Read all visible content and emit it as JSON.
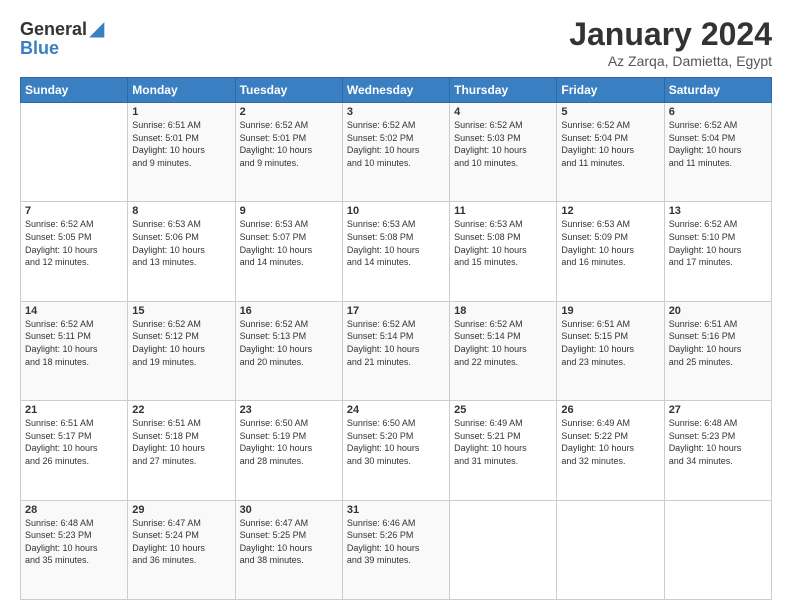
{
  "header": {
    "logo_line1": "General",
    "logo_line2": "Blue",
    "title": "January 2024",
    "subtitle": "Az Zarqa, Damietta, Egypt"
  },
  "weekdays": [
    "Sunday",
    "Monday",
    "Tuesday",
    "Wednesday",
    "Thursday",
    "Friday",
    "Saturday"
  ],
  "weeks": [
    [
      {
        "day": "",
        "info": ""
      },
      {
        "day": "1",
        "info": "Sunrise: 6:51 AM\nSunset: 5:01 PM\nDaylight: 10 hours\nand 9 minutes."
      },
      {
        "day": "2",
        "info": "Sunrise: 6:52 AM\nSunset: 5:01 PM\nDaylight: 10 hours\nand 9 minutes."
      },
      {
        "day": "3",
        "info": "Sunrise: 6:52 AM\nSunset: 5:02 PM\nDaylight: 10 hours\nand 10 minutes."
      },
      {
        "day": "4",
        "info": "Sunrise: 6:52 AM\nSunset: 5:03 PM\nDaylight: 10 hours\nand 10 minutes."
      },
      {
        "day": "5",
        "info": "Sunrise: 6:52 AM\nSunset: 5:04 PM\nDaylight: 10 hours\nand 11 minutes."
      },
      {
        "day": "6",
        "info": "Sunrise: 6:52 AM\nSunset: 5:04 PM\nDaylight: 10 hours\nand 11 minutes."
      }
    ],
    [
      {
        "day": "7",
        "info": "Sunrise: 6:52 AM\nSunset: 5:05 PM\nDaylight: 10 hours\nand 12 minutes."
      },
      {
        "day": "8",
        "info": "Sunrise: 6:53 AM\nSunset: 5:06 PM\nDaylight: 10 hours\nand 13 minutes."
      },
      {
        "day": "9",
        "info": "Sunrise: 6:53 AM\nSunset: 5:07 PM\nDaylight: 10 hours\nand 14 minutes."
      },
      {
        "day": "10",
        "info": "Sunrise: 6:53 AM\nSunset: 5:08 PM\nDaylight: 10 hours\nand 14 minutes."
      },
      {
        "day": "11",
        "info": "Sunrise: 6:53 AM\nSunset: 5:08 PM\nDaylight: 10 hours\nand 15 minutes."
      },
      {
        "day": "12",
        "info": "Sunrise: 6:53 AM\nSunset: 5:09 PM\nDaylight: 10 hours\nand 16 minutes."
      },
      {
        "day": "13",
        "info": "Sunrise: 6:52 AM\nSunset: 5:10 PM\nDaylight: 10 hours\nand 17 minutes."
      }
    ],
    [
      {
        "day": "14",
        "info": "Sunrise: 6:52 AM\nSunset: 5:11 PM\nDaylight: 10 hours\nand 18 minutes."
      },
      {
        "day": "15",
        "info": "Sunrise: 6:52 AM\nSunset: 5:12 PM\nDaylight: 10 hours\nand 19 minutes."
      },
      {
        "day": "16",
        "info": "Sunrise: 6:52 AM\nSunset: 5:13 PM\nDaylight: 10 hours\nand 20 minutes."
      },
      {
        "day": "17",
        "info": "Sunrise: 6:52 AM\nSunset: 5:14 PM\nDaylight: 10 hours\nand 21 minutes."
      },
      {
        "day": "18",
        "info": "Sunrise: 6:52 AM\nSunset: 5:14 PM\nDaylight: 10 hours\nand 22 minutes."
      },
      {
        "day": "19",
        "info": "Sunrise: 6:51 AM\nSunset: 5:15 PM\nDaylight: 10 hours\nand 23 minutes."
      },
      {
        "day": "20",
        "info": "Sunrise: 6:51 AM\nSunset: 5:16 PM\nDaylight: 10 hours\nand 25 minutes."
      }
    ],
    [
      {
        "day": "21",
        "info": "Sunrise: 6:51 AM\nSunset: 5:17 PM\nDaylight: 10 hours\nand 26 minutes."
      },
      {
        "day": "22",
        "info": "Sunrise: 6:51 AM\nSunset: 5:18 PM\nDaylight: 10 hours\nand 27 minutes."
      },
      {
        "day": "23",
        "info": "Sunrise: 6:50 AM\nSunset: 5:19 PM\nDaylight: 10 hours\nand 28 minutes."
      },
      {
        "day": "24",
        "info": "Sunrise: 6:50 AM\nSunset: 5:20 PM\nDaylight: 10 hours\nand 30 minutes."
      },
      {
        "day": "25",
        "info": "Sunrise: 6:49 AM\nSunset: 5:21 PM\nDaylight: 10 hours\nand 31 minutes."
      },
      {
        "day": "26",
        "info": "Sunrise: 6:49 AM\nSunset: 5:22 PM\nDaylight: 10 hours\nand 32 minutes."
      },
      {
        "day": "27",
        "info": "Sunrise: 6:48 AM\nSunset: 5:23 PM\nDaylight: 10 hours\nand 34 minutes."
      }
    ],
    [
      {
        "day": "28",
        "info": "Sunrise: 6:48 AM\nSunset: 5:23 PM\nDaylight: 10 hours\nand 35 minutes."
      },
      {
        "day": "29",
        "info": "Sunrise: 6:47 AM\nSunset: 5:24 PM\nDaylight: 10 hours\nand 36 minutes."
      },
      {
        "day": "30",
        "info": "Sunrise: 6:47 AM\nSunset: 5:25 PM\nDaylight: 10 hours\nand 38 minutes."
      },
      {
        "day": "31",
        "info": "Sunrise: 6:46 AM\nSunset: 5:26 PM\nDaylight: 10 hours\nand 39 minutes."
      },
      {
        "day": "",
        "info": ""
      },
      {
        "day": "",
        "info": ""
      },
      {
        "day": "",
        "info": ""
      }
    ]
  ]
}
